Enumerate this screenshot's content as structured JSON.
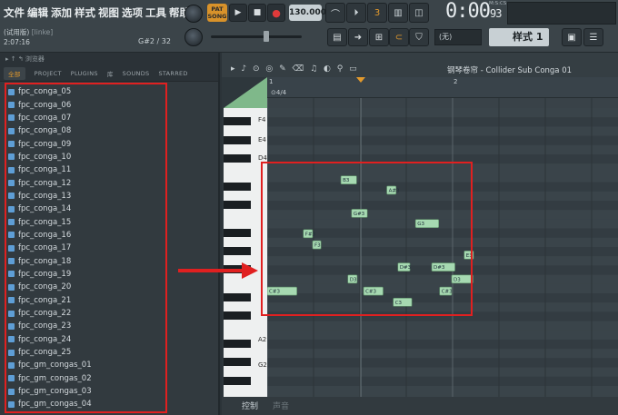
{
  "menu": [
    "文件",
    "编辑",
    "添加",
    "样式",
    "视图",
    "选项",
    "工具",
    "帮助"
  ],
  "project": {
    "name": "(试用版)",
    "hint": "[linke]",
    "time": "2:07:16",
    "note_hint": "G#2 / 32"
  },
  "transport": {
    "pat": "PAT",
    "song": "SONG",
    "tempo": "130.000",
    "time": "0:00",
    "time_small": "93",
    "mcs": "M:S:CS",
    "snap": "(无)",
    "pattern": "样式 1"
  },
  "browser": {
    "title": "浏览器",
    "tabs": [
      "全部",
      "PROJECT",
      "PLUGINS",
      "库",
      "SOUNDS",
      "STARRED"
    ],
    "items": [
      "fpc_conga_05",
      "fpc_conga_06",
      "fpc_conga_07",
      "fpc_conga_08",
      "fpc_conga_09",
      "fpc_conga_10",
      "fpc_conga_11",
      "fpc_conga_12",
      "fpc_conga_13",
      "fpc_conga_14",
      "fpc_conga_15",
      "fpc_conga_16",
      "fpc_conga_17",
      "fpc_conga_18",
      "fpc_conga_19",
      "fpc_conga_20",
      "fpc_conga_21",
      "fpc_conga_22",
      "fpc_conga_23",
      "fpc_conga_24",
      "fpc_conga_25",
      "fpc_gm_congas_01",
      "fpc_gm_congas_02",
      "fpc_gm_congas_03",
      "fpc_gm_congas_04"
    ]
  },
  "piano_roll": {
    "title": "钢琴卷帘 - Collider Sub Conga 01",
    "bars": [
      "1",
      "2"
    ],
    "time_sig": "4/4",
    "key_labels": [
      "F4",
      "E4",
      "D4",
      "A2",
      "G2"
    ],
    "notes": [
      {
        "label": "B3",
        "bar": 1.59,
        "len": 0.34
      },
      {
        "label": "A#3",
        "bar": 2.58,
        "len": 0.2
      },
      {
        "label": "G#3",
        "bar": 1.82,
        "len": 0.34
      },
      {
        "label": "G3",
        "bar": 3.2,
        "len": 0.5
      },
      {
        "label": "F#3",
        "bar": 0.78,
        "len": 0.2
      },
      {
        "label": "F3",
        "bar": 0.98,
        "len": 0.18
      },
      {
        "label": "E3",
        "bar": 4.25,
        "len": 0.2
      },
      {
        "label": "D#3",
        "bar": 2.82,
        "len": 0.26
      },
      {
        "label": "D#3",
        "bar": 3.55,
        "len": 0.5
      },
      {
        "label": "D3",
        "bar": 1.74,
        "len": 0.2
      },
      {
        "label": "D3",
        "bar": 3.98,
        "len": 0.46
      },
      {
        "label": "C#3",
        "bar": 0.0,
        "len": 0.64
      },
      {
        "label": "C#3",
        "bar": 2.08,
        "len": 0.42
      },
      {
        "label": "C#3",
        "bar": 3.72,
        "len": 0.26
      },
      {
        "label": "C3",
        "bar": 2.72,
        "len": 0.4
      }
    ],
    "bottom_label": "控制",
    "bottom_label2": "声音"
  },
  "colors": {
    "note": "#a6d9b1",
    "highlight": "#e02020",
    "accent": "#e39a2c"
  }
}
